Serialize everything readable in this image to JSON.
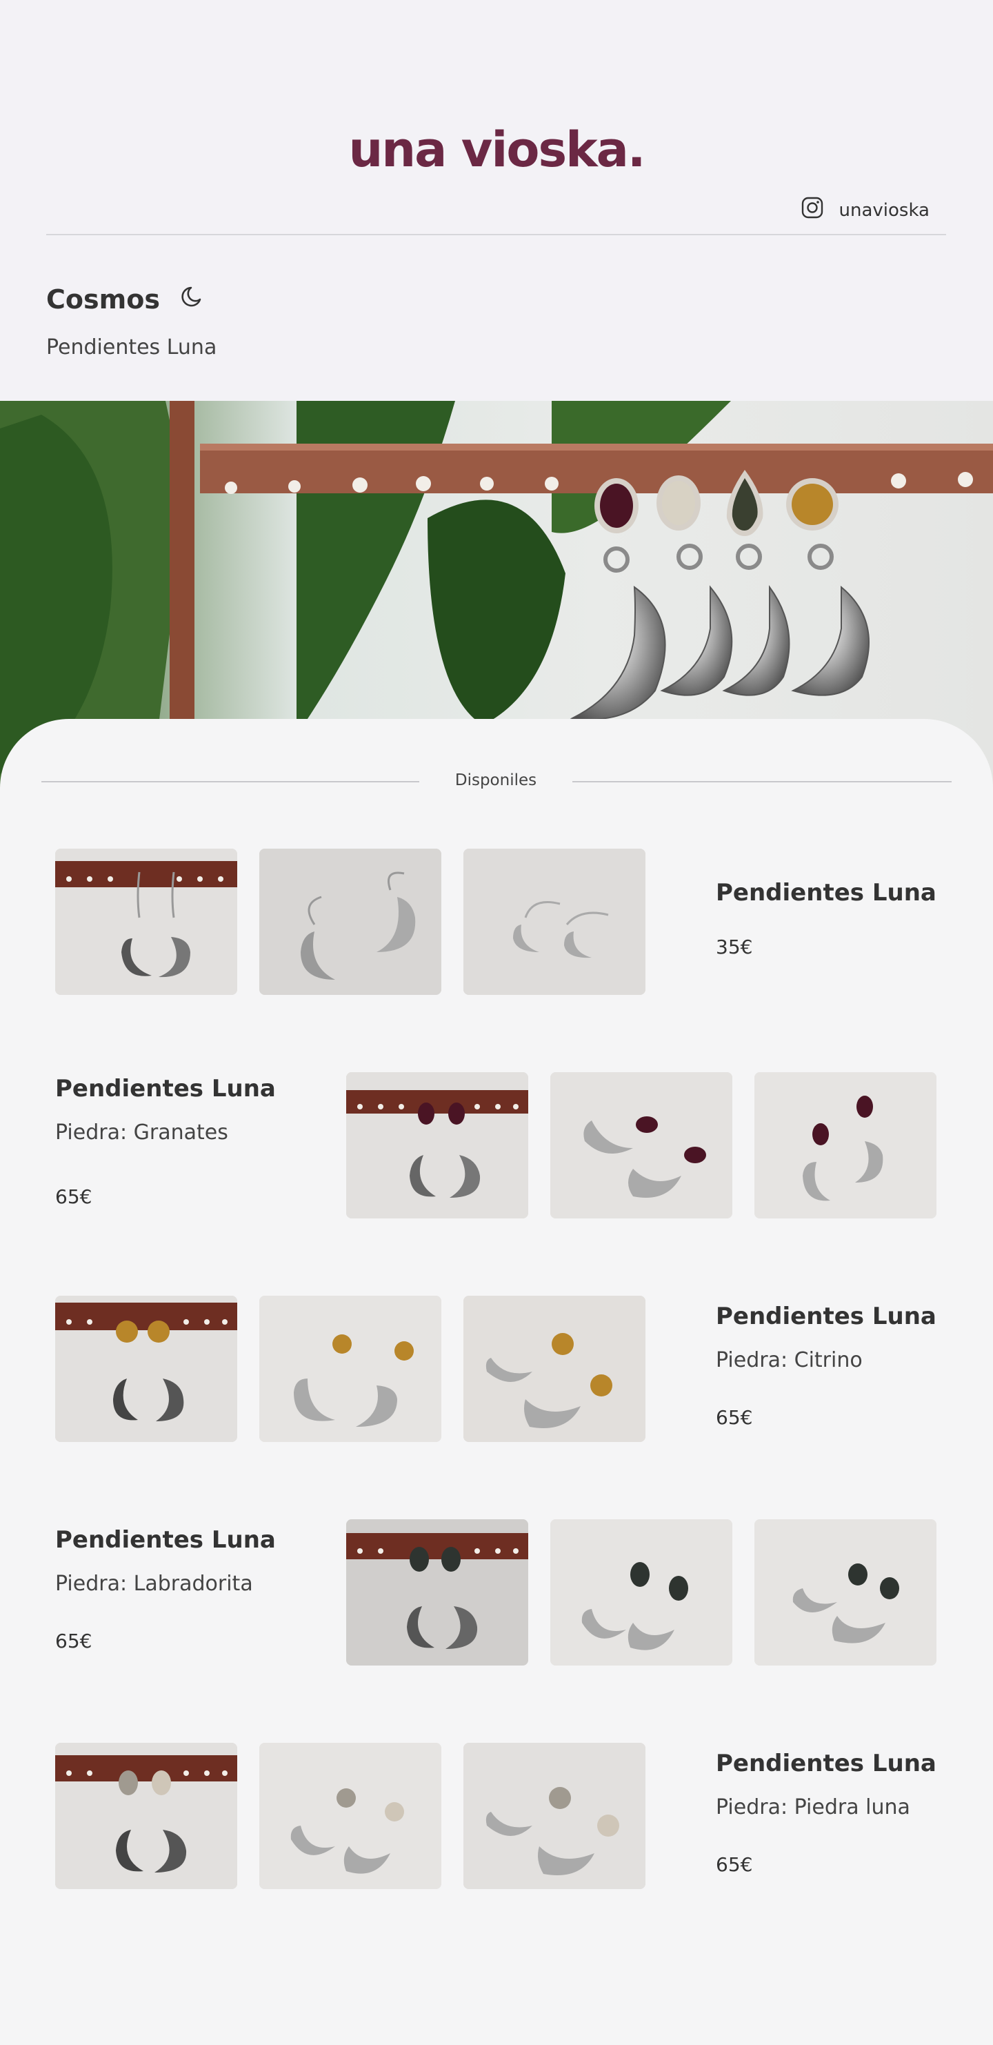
{
  "brand": {
    "logo": "una vioska.",
    "accent": "#6b2844"
  },
  "social": {
    "icon": "instagram-icon",
    "handle": "unavioska"
  },
  "collection": {
    "title": "Cosmos",
    "icon": "moon-icon",
    "subtitle": "Pendientes Luna"
  },
  "section": {
    "label": "Disponiles"
  },
  "products": [
    {
      "name": "Pendientes Luna",
      "stone": "",
      "price": "35€",
      "stone_color": ""
    },
    {
      "name": "Pendientes Luna",
      "stone": "Piedra: Granates",
      "price": "65€",
      "stone_color": "#4a1424"
    },
    {
      "name": "Pendientes Luna",
      "stone": "Piedra: Citrino",
      "price": "65€",
      "stone_color": "#b8862a"
    },
    {
      "name": "Pendientes Luna",
      "stone": "Piedra: Labradorita",
      "price": "65€",
      "stone_color": "#2e3430"
    },
    {
      "name": "Pendientes Luna",
      "stone": "Piedra: Piedra luna",
      "price": "65€",
      "stone_color": "#cfc6b8"
    }
  ]
}
